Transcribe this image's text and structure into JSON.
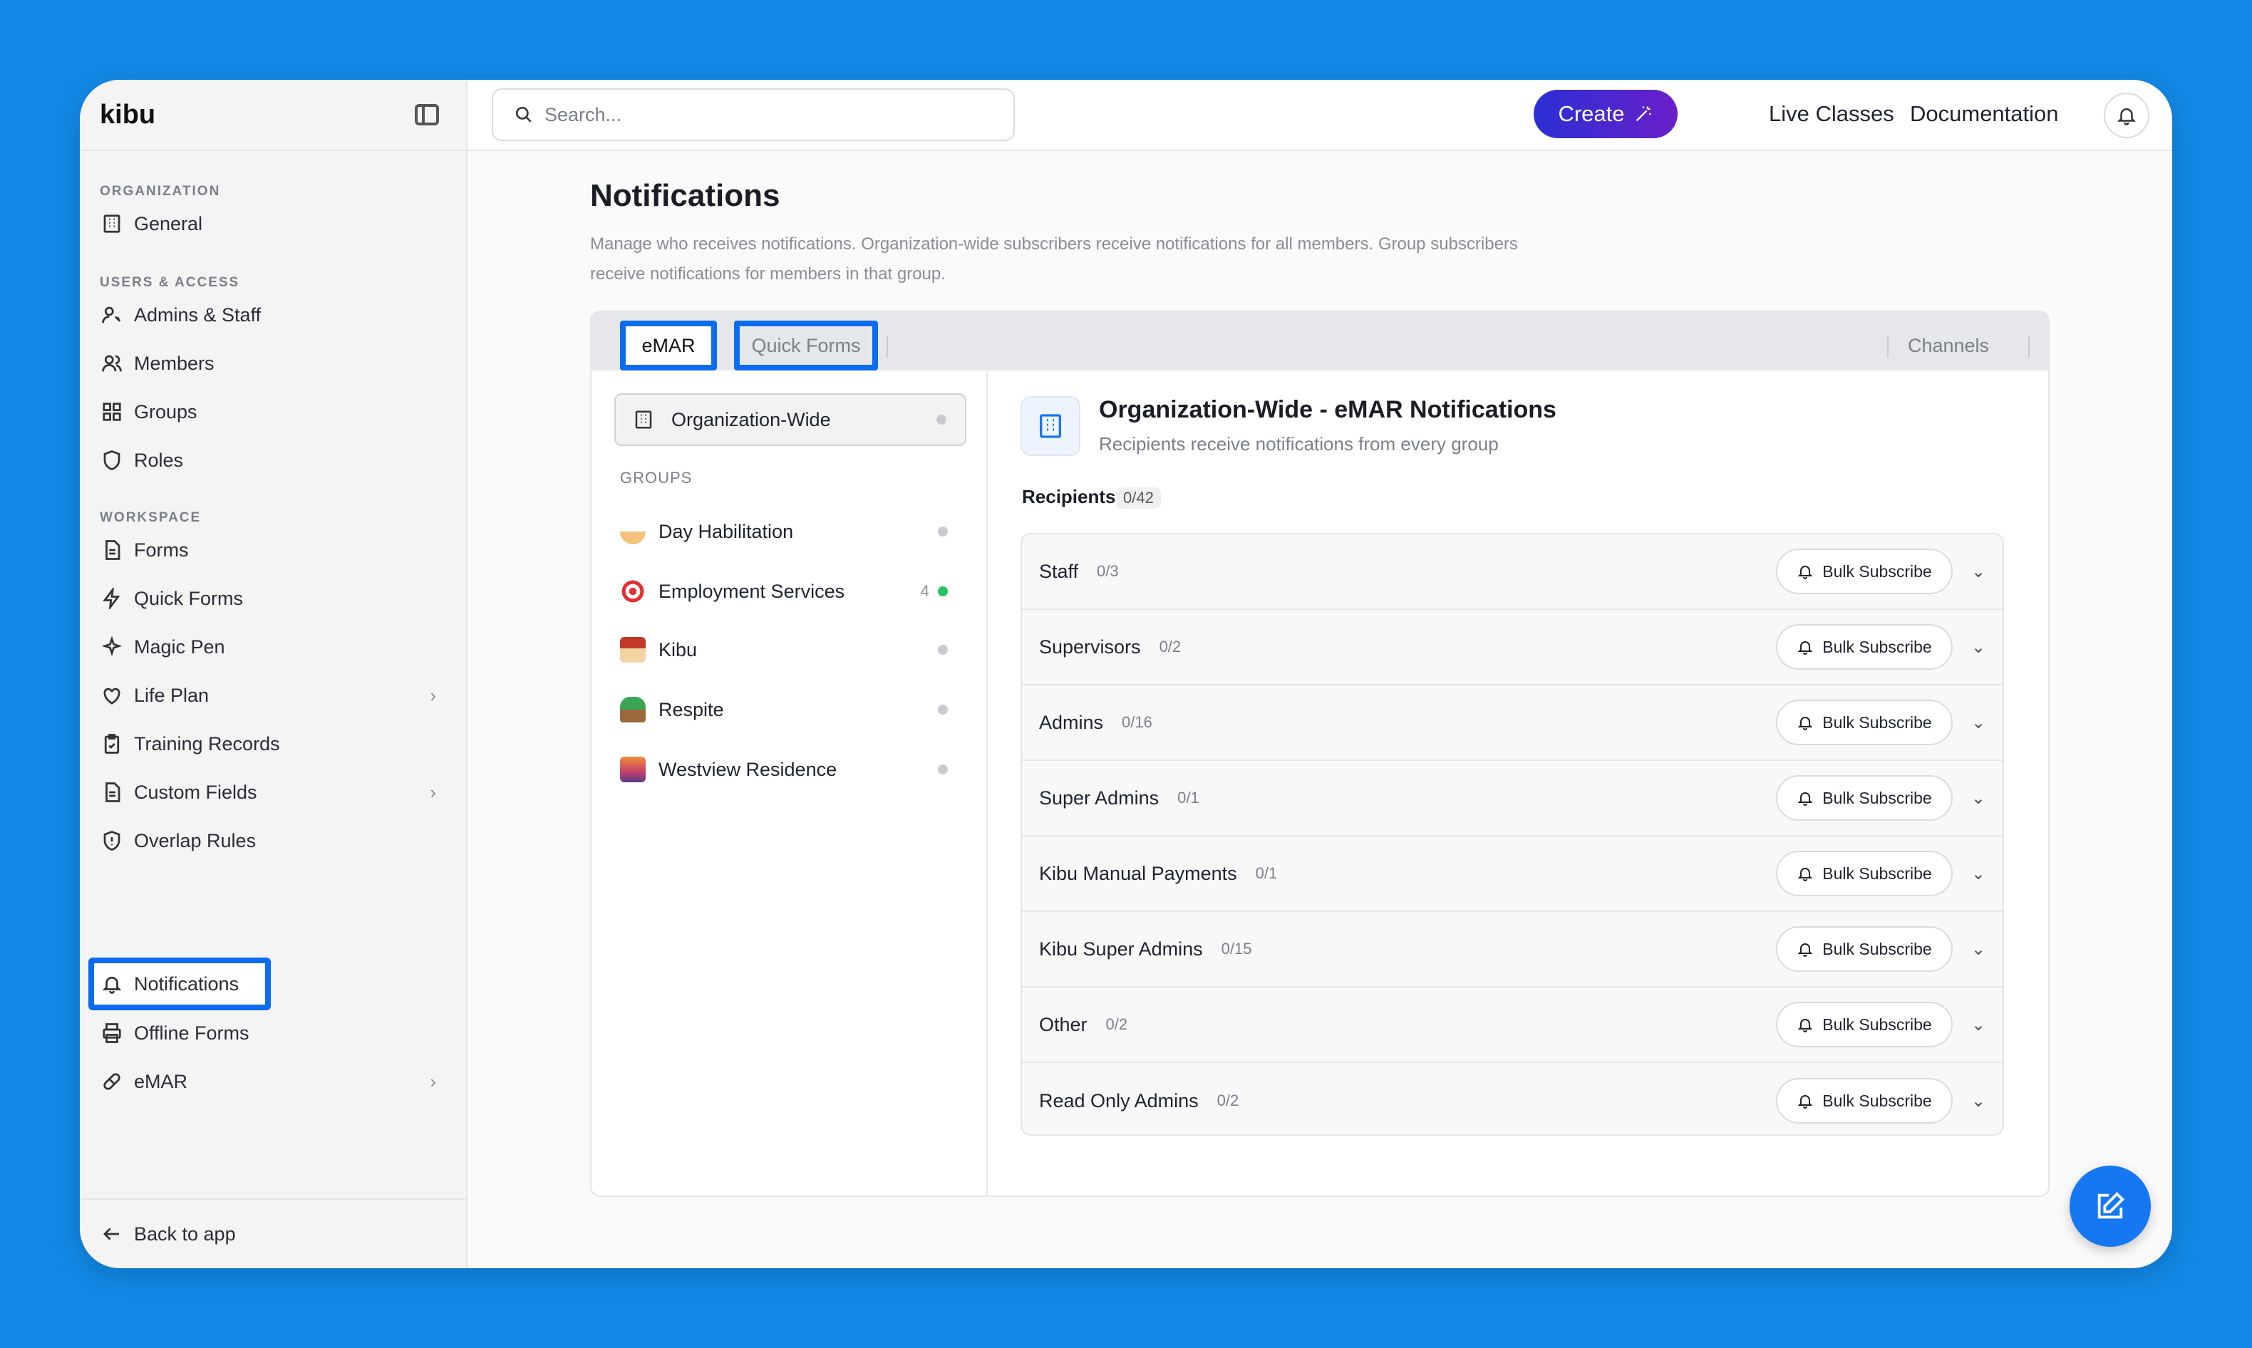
{
  "app": {
    "brand": "kibu"
  },
  "search": {
    "placeholder": "Search..."
  },
  "topbar": {
    "create_label": "Create",
    "live_classes": "Live Classes",
    "documentation": "Documentation"
  },
  "sidebar": {
    "sections": {
      "organization": "ORGANIZATION",
      "users_access": "USERS & ACCESS",
      "workspace": "WORKSPACE"
    },
    "items": {
      "general": "General",
      "admins_staff": "Admins & Staff",
      "members": "Members",
      "groups": "Groups",
      "roles": "Roles",
      "forms": "Forms",
      "quick_forms": "Quick Forms",
      "magic_pen": "Magic Pen",
      "life_plan": "Life Plan",
      "training_records": "Training Records",
      "custom_fields": "Custom Fields",
      "overlap_rules": "Overlap Rules",
      "notifications": "Notifications",
      "offline_forms": "Offline Forms",
      "emar": "eMAR"
    },
    "back": "Back to app"
  },
  "page": {
    "title": "Notifications",
    "description": "Manage who receives notifications. Organization-wide subscribers receive notifications for all members. Group subscribers receive notifications for members in that group."
  },
  "tabs": {
    "emar": "eMAR",
    "quick_forms": "Quick Forms",
    "channels": "Channels"
  },
  "left": {
    "org_wide": "Organization-Wide",
    "groups_label": "GROUPS",
    "groups": [
      {
        "name": "Day Habilitation",
        "count": ""
      },
      {
        "name": "Employment Services",
        "count": "4"
      },
      {
        "name": "Kibu",
        "count": ""
      },
      {
        "name": "Respite",
        "count": ""
      },
      {
        "name": "Westview Residence",
        "count": ""
      }
    ]
  },
  "right": {
    "title": "Organization-Wide - eMAR Notifications",
    "subtitle": "Recipients receive notifications from every group",
    "recipients_label": "Recipients",
    "recipients_count": "0/42",
    "bulk_label": "Bulk Subscribe",
    "rows": [
      {
        "name": "Staff",
        "count": "0/3"
      },
      {
        "name": "Supervisors",
        "count": "0/2"
      },
      {
        "name": "Admins",
        "count": "0/16"
      },
      {
        "name": "Super Admins",
        "count": "0/1"
      },
      {
        "name": "Kibu Manual Payments",
        "count": "0/1"
      },
      {
        "name": "Kibu Super Admins",
        "count": "0/15"
      },
      {
        "name": "Other",
        "count": "0/2"
      },
      {
        "name": "Read Only Admins",
        "count": "0/2"
      }
    ]
  },
  "colors": {
    "accent": "#1677f2",
    "highlight": "#0b6cf0",
    "create_start": "#2b2fd4",
    "create_end": "#6a1fc9",
    "background": "#1289e6"
  }
}
